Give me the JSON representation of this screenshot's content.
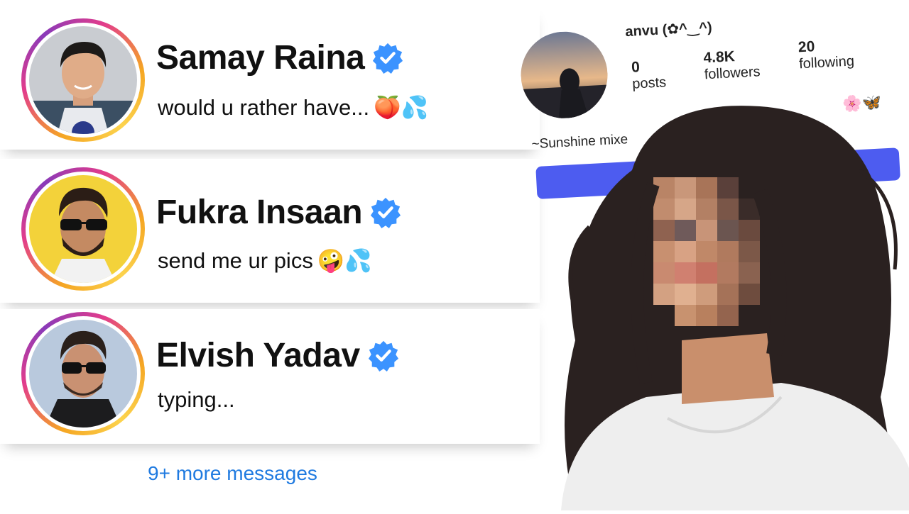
{
  "messages": [
    {
      "name": "Samay Raina",
      "preview": "would u rather have...",
      "emojis": "🍑💦",
      "verified": true
    },
    {
      "name": "Fukra Insaan",
      "preview": "send me ur pics",
      "emojis": "🤪💦",
      "verified": true
    },
    {
      "name": "Elvish Yadav",
      "preview": "typing...",
      "emojis": "",
      "verified": true
    }
  ],
  "more_messages_label": "9+ more messages",
  "profile": {
    "username": "anvu (✿^‿^)",
    "posts_count": "0",
    "posts_label": "posts",
    "followers_count": "4.8K",
    "followers_label": "followers",
    "following_count": "20",
    "following_label": "following",
    "bio": "~Sunshine mixe",
    "bio_emoji": "🌸🦋"
  },
  "colors": {
    "verified_blue": "#3b93ff",
    "link_blue": "#1f7ae0",
    "follow_button": "#4d5cf0"
  },
  "icons": [
    "verified-badge-icon",
    "peach-emoji",
    "droplets-emoji",
    "zany-face-emoji"
  ]
}
